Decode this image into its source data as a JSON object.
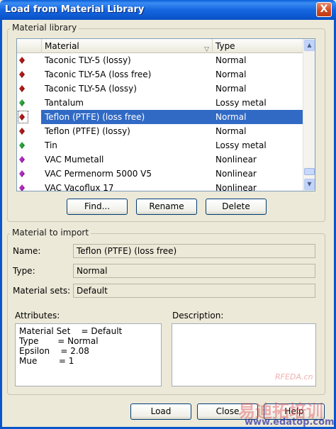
{
  "window": {
    "title": "Load from Material Library",
    "close_glyph": "X"
  },
  "library": {
    "group_label": "Material library",
    "columns": [
      "Material",
      "Type"
    ],
    "rows": [
      {
        "icon_color": "#b01c1c",
        "material": "Taconic TLY-5 (lossy)",
        "type": "Normal"
      },
      {
        "icon_color": "#b01c1c",
        "material": "Taconic TLY-5A (loss free)",
        "type": "Normal"
      },
      {
        "icon_color": "#b01c1c",
        "material": "Taconic TLY-5A (lossy)",
        "type": "Normal"
      },
      {
        "icon_color": "#2aa83a",
        "material": "Tantalum",
        "type": "Lossy metal"
      },
      {
        "icon_color": "#b01c1c",
        "material": "Teflon (PTFE) (loss free)",
        "type": "Normal",
        "selected": true
      },
      {
        "icon_color": "#b01c1c",
        "material": "Teflon (PTFE) (lossy)",
        "type": "Normal"
      },
      {
        "icon_color": "#2aa83a",
        "material": "Tin",
        "type": "Lossy metal"
      },
      {
        "icon_color": "#b22cc0",
        "material": "VAC Mumetall",
        "type": "Nonlinear"
      },
      {
        "icon_color": "#b22cc0",
        "material": "VAC Permenorm 5000 V5",
        "type": "Nonlinear"
      },
      {
        "icon_color": "#b22cc0",
        "material": "VAC Vacoflux 17",
        "type": "Nonlinear"
      }
    ],
    "buttons": {
      "find": "Find...",
      "rename": "Rename",
      "delete": "Delete"
    }
  },
  "import": {
    "group_label": "Material to import",
    "name_label": "Name:",
    "name_value": "Teflon (PTFE) (loss free)",
    "type_label": "Type:",
    "type_value": "Normal",
    "sets_label": "Material sets:",
    "sets_value": "Default",
    "attributes_label": "Attributes:",
    "attributes_lines": [
      "Material Set    = Default",
      "Type       = Normal",
      "Epsilon    = 2.08",
      "Mue        = 1"
    ],
    "description_label": "Description:",
    "description_value": ""
  },
  "footer": {
    "load": "Load",
    "close": "Close",
    "help": "Help"
  },
  "watermarks": {
    "site_top": "RFEDA.cn",
    "brand": "易迪拓培训",
    "url": "www.edatop.com"
  }
}
